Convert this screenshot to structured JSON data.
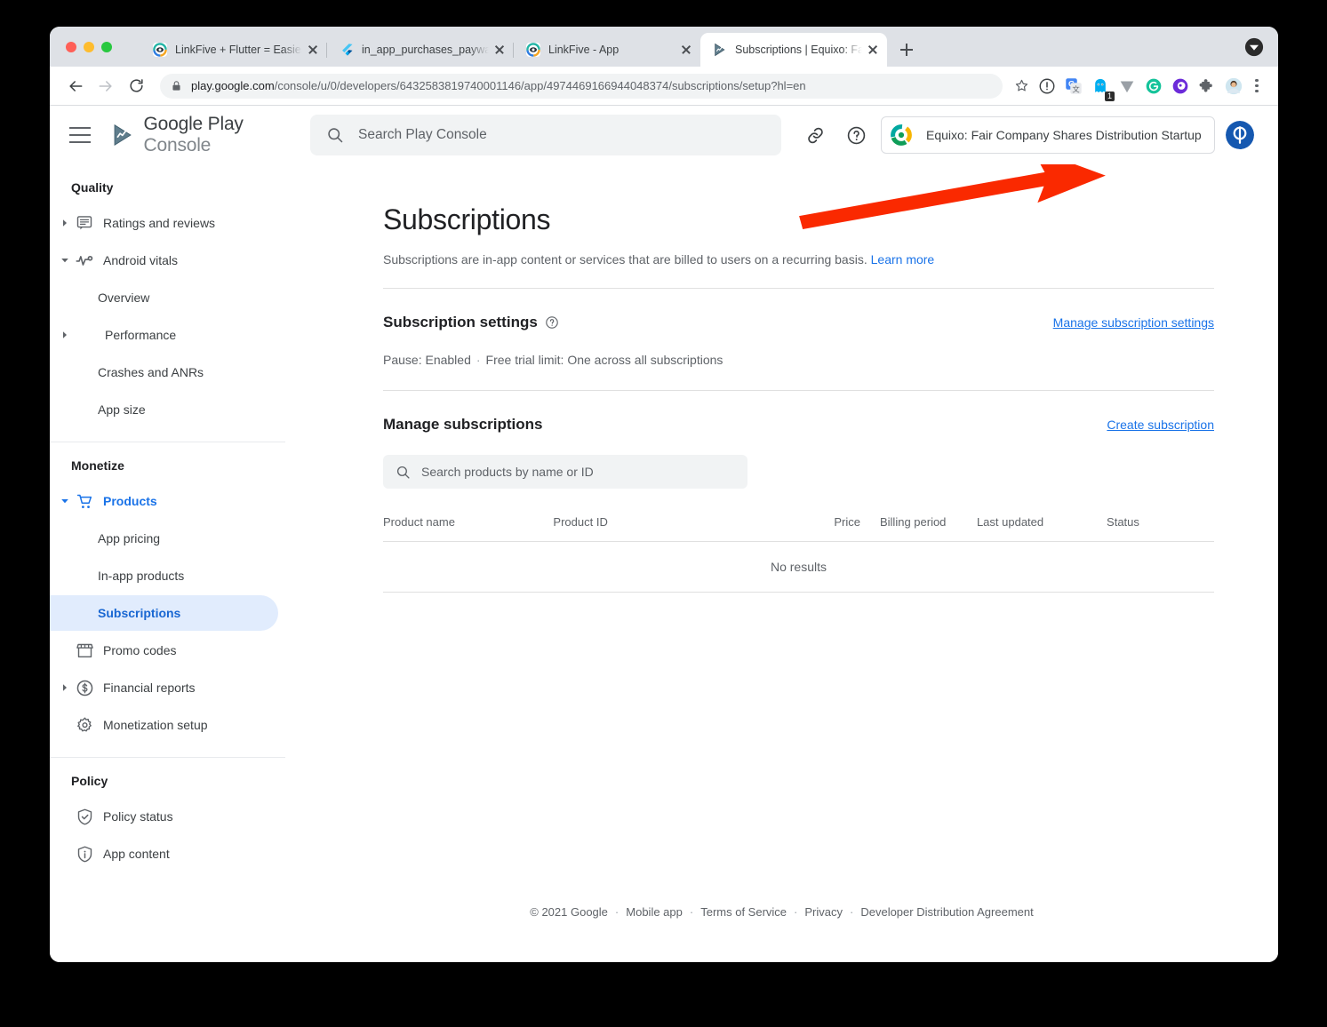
{
  "browser": {
    "tabs": [
      {
        "title": "LinkFive + Flutter = Easiest Inte",
        "favicon": "linkfive-icon",
        "active": false
      },
      {
        "title": "in_app_purchases_paywall_ui",
        "favicon": "flutter-icon",
        "active": false
      },
      {
        "title": "LinkFive - App",
        "favicon": "linkfive-icon",
        "active": false
      },
      {
        "title": "Subscriptions | Equixo: Fair Co",
        "favicon": "play-console-icon",
        "active": true
      }
    ],
    "new_tab_label": "+",
    "url": {
      "host": "play.google.com",
      "path": "/console/u/0/developers/6432583819740001146/app/4974469166944048374/subscriptions/setup?hl=en"
    },
    "extensions": [
      "info-icon",
      "google-translate-icon",
      "ghostery-icon",
      "vimeo-icon",
      "grammarly-icon",
      "purple-circle-icon",
      "puzzle-extensions-icon",
      "profile-avatar-icon"
    ],
    "ghostery_badge": "1"
  },
  "header": {
    "menu_icon": "hamburger-icon",
    "logo_icon": "google-play-console-logo",
    "brand_google_play": "Google Play",
    "brand_console": "Console",
    "search_placeholder": "Search Play Console",
    "search_value": "",
    "link_icon": "link-icon",
    "help_icon": "help-circle-icon",
    "app_name": "Equixo: Fair Company Shares Distribution Startup",
    "app_icon": "equixo-app-icon",
    "account_avatar": "account-avatar-icon"
  },
  "sidebar": {
    "sections": [
      {
        "title": "Quality",
        "items": [
          {
            "label": "Ratings and reviews",
            "icon": "reviews-icon",
            "caret": "right",
            "level": 0,
            "state": ""
          },
          {
            "label": "Android vitals",
            "icon": "vitals-icon",
            "caret": "down",
            "level": 0,
            "state": ""
          },
          {
            "label": "Overview",
            "icon": "",
            "caret": "",
            "level": 1,
            "state": ""
          },
          {
            "label": "Performance",
            "icon": "",
            "caret": "right",
            "level": 1,
            "state": ""
          },
          {
            "label": "Crashes and ANRs",
            "icon": "",
            "caret": "",
            "level": 1,
            "state": ""
          },
          {
            "label": "App size",
            "icon": "",
            "caret": "",
            "level": 1,
            "state": ""
          }
        ]
      },
      {
        "title": "Monetize",
        "items": [
          {
            "label": "Products",
            "icon": "cart-icon",
            "caret": "down",
            "level": 0,
            "state": "open"
          },
          {
            "label": "App pricing",
            "icon": "",
            "caret": "",
            "level": 1,
            "state": ""
          },
          {
            "label": "In-app products",
            "icon": "",
            "caret": "",
            "level": 1,
            "state": ""
          },
          {
            "label": "Subscriptions",
            "icon": "",
            "caret": "",
            "level": 1,
            "state": "active"
          },
          {
            "label": "Promo codes",
            "icon": "promo-icon",
            "caret": "",
            "level": 0,
            "state": ""
          },
          {
            "label": "Financial reports",
            "icon": "dollar-icon",
            "caret": "right",
            "level": 0,
            "state": ""
          },
          {
            "label": "Monetization setup",
            "icon": "gear-icon",
            "caret": "",
            "level": 0,
            "state": ""
          }
        ]
      },
      {
        "title": "Policy",
        "items": [
          {
            "label": "Policy status",
            "icon": "shield-check-icon",
            "caret": "",
            "level": 0,
            "state": ""
          },
          {
            "label": "App content",
            "icon": "shield-info-icon",
            "caret": "",
            "level": 0,
            "state": ""
          }
        ]
      }
    ]
  },
  "main": {
    "title": "Subscriptions",
    "description": "Subscriptions are in-app content or services that are billed to users on a recurring basis.",
    "description_link": "Learn more",
    "settings": {
      "heading": "Subscription settings",
      "help_icon": "help-circle-icon",
      "manage_link": "Manage subscription settings",
      "pause": "Pause: Enabled",
      "separator": "·",
      "free_trial": "Free trial limit: One across all subscriptions"
    },
    "manage": {
      "heading": "Manage subscriptions",
      "create_link": "Create subscription",
      "search_placeholder": "Search products by name or ID",
      "search_value": "",
      "search_icon": "search-icon"
    },
    "table": {
      "columns": [
        "Product name",
        "Product ID",
        "Price",
        "Billing period",
        "Last updated",
        "Status"
      ],
      "rows": [],
      "empty_message": "No results"
    },
    "annotation": {
      "type": "arrow",
      "color": "#FA2900",
      "points_to": "Create subscription"
    }
  },
  "footer": {
    "copyright": "© 2021 Google",
    "separator": "·",
    "links": [
      "Mobile app",
      "Terms of Service",
      "Privacy",
      "Developer Distribution Agreement"
    ]
  }
}
